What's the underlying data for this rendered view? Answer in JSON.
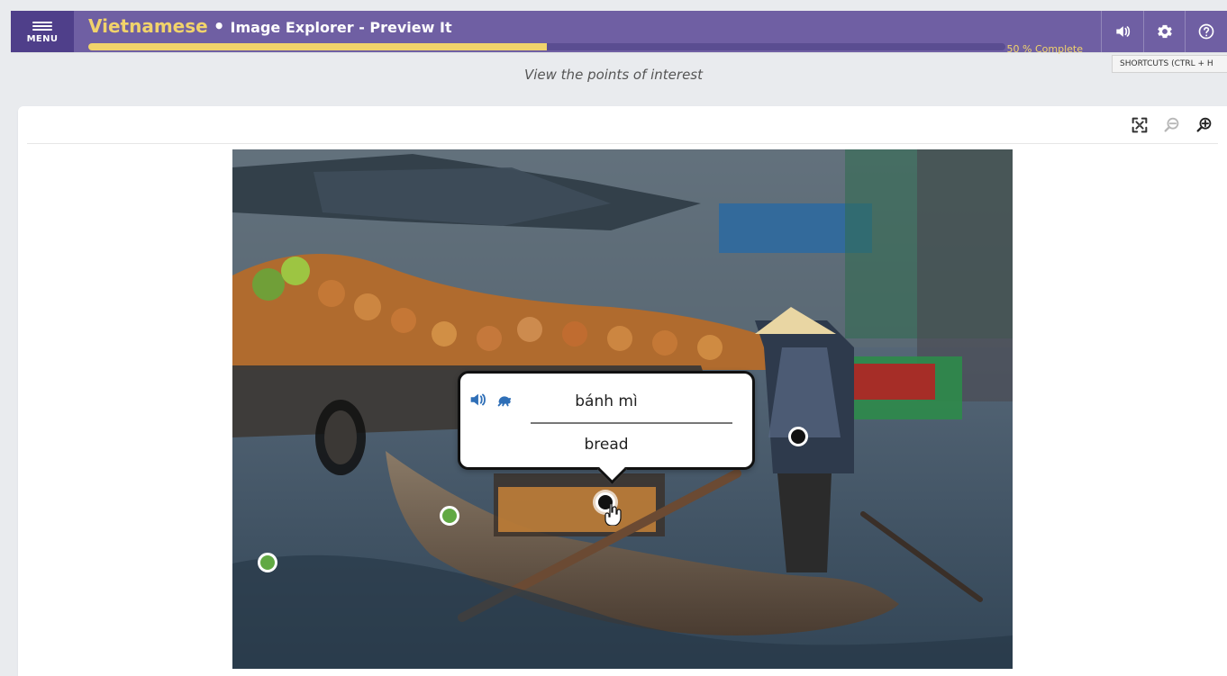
{
  "header": {
    "menu_label": "MENU",
    "language": "Vietnamese",
    "separator": "•",
    "activity": "Image Explorer - Preview It",
    "progress_text": "50 % Complete",
    "progress_fraction": 0.5,
    "colors": {
      "bar": "#6f5fa3",
      "menu_bg": "#4f3f8a",
      "accent": "#f1d36b"
    },
    "buttons": [
      {
        "name": "sound-icon"
      },
      {
        "name": "gear-icon"
      },
      {
        "name": "help-icon"
      }
    ],
    "tooltip": "SHORTCUTS (CTRL + H"
  },
  "instruction": "View the points of interest",
  "toolbar": {
    "icons": [
      "fullscreen-icon",
      "zoom-out-icon",
      "zoom-in-icon"
    ]
  },
  "popup": {
    "vietnamese": "bánh mì",
    "english": "bread",
    "icons": [
      "audio-icon",
      "slow-audio-icon"
    ]
  }
}
